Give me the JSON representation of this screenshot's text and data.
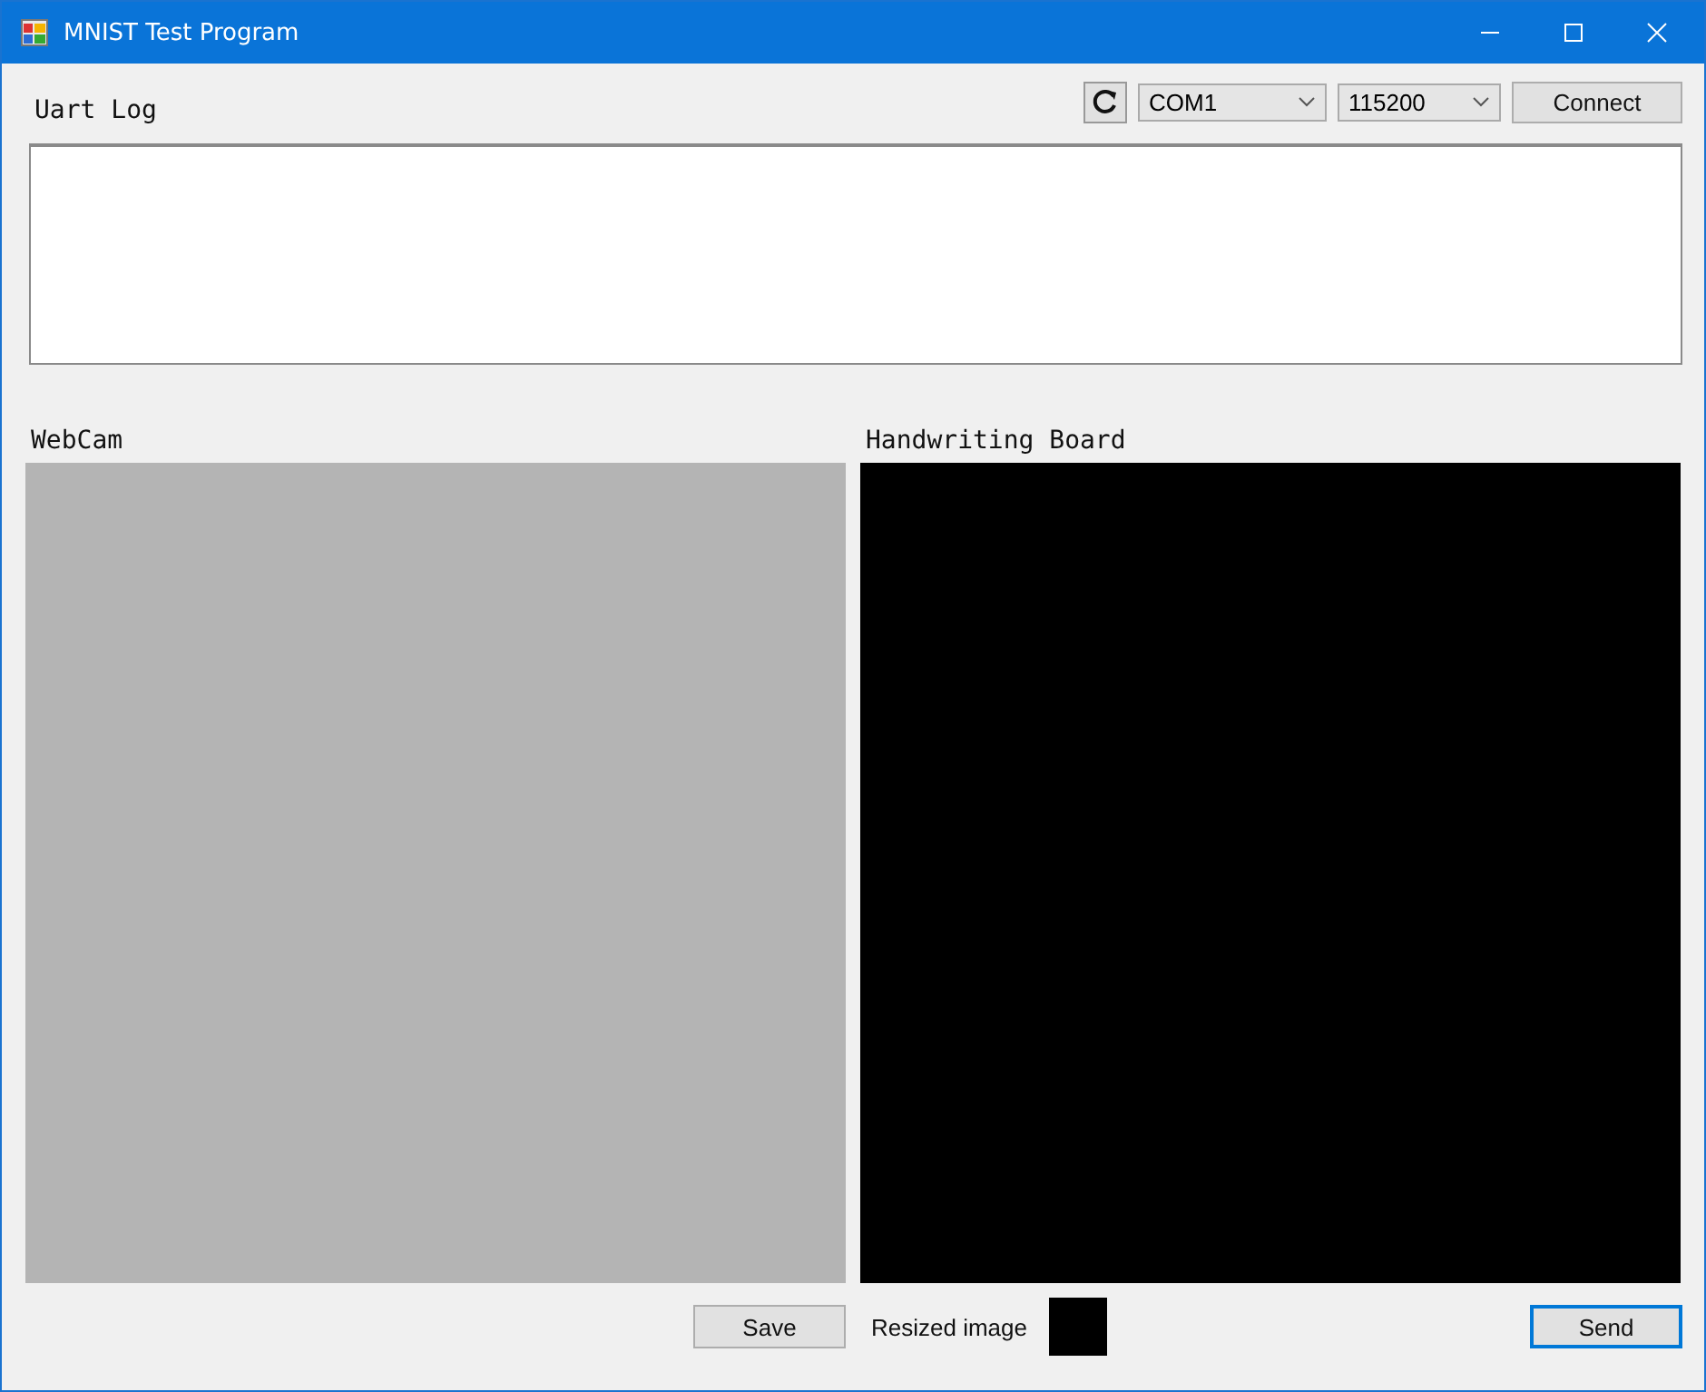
{
  "window": {
    "title": "MNIST Test Program"
  },
  "uart": {
    "label": "Uart Log",
    "port": "COM1",
    "baud": "115200",
    "connect": "Connect"
  },
  "webcam": {
    "label": "WebCam"
  },
  "board": {
    "label": "Handwriting Board"
  },
  "bottom": {
    "save": {
      "label": "Save",
      "focused": false
    },
    "resized_label": "Resized image",
    "send": {
      "label": "Send",
      "focused": true
    }
  }
}
